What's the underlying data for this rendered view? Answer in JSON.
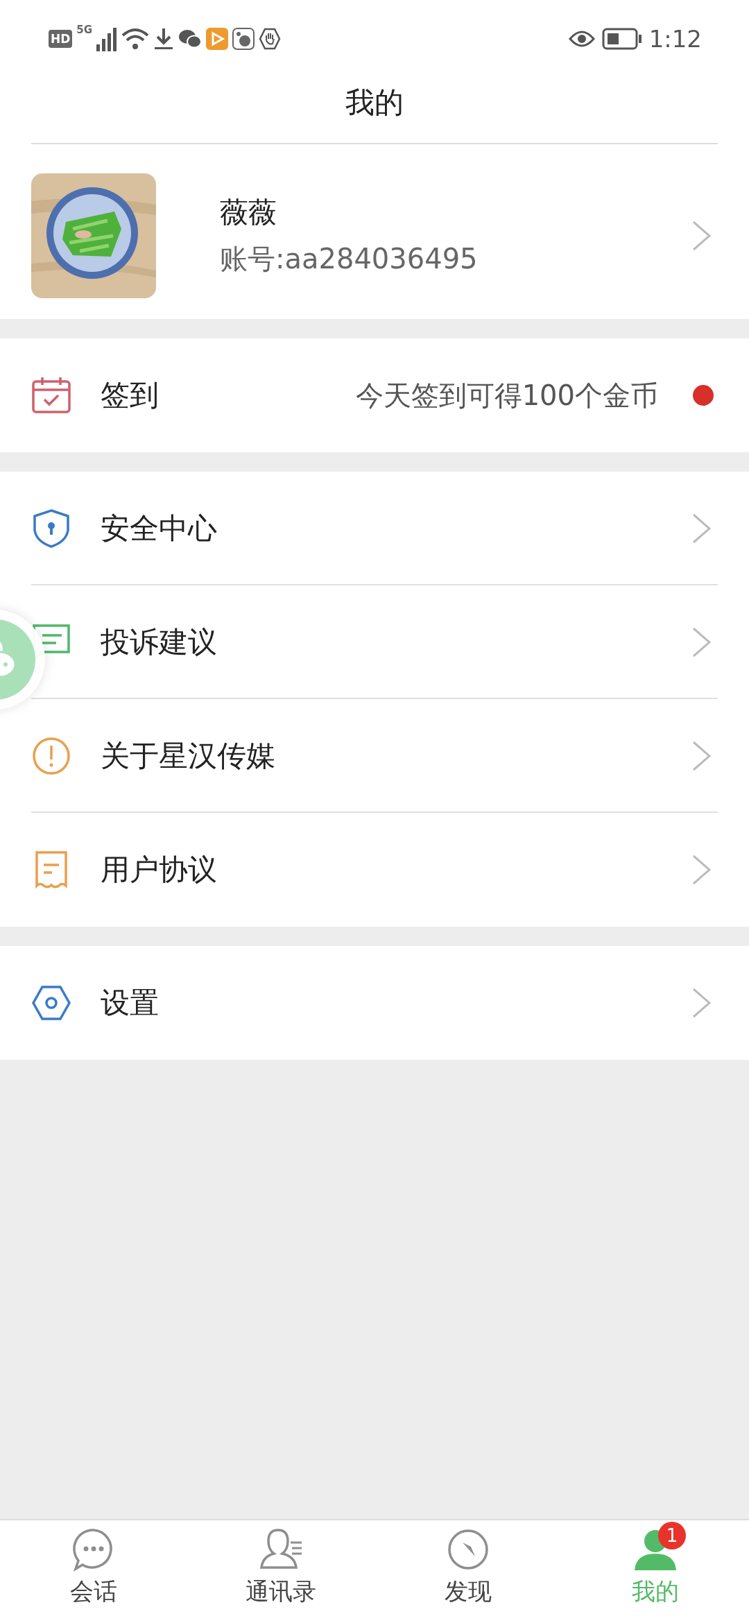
{
  "status_bar": {
    "badges": [
      "HD",
      "5G"
    ],
    "time": "1:12"
  },
  "header": {
    "title": "我的"
  },
  "profile": {
    "name": "薇薇",
    "account": "账号:aa284036495"
  },
  "groups": [
    {
      "items": [
        {
          "kind": "checkin",
          "color": "#d0606e",
          "label": "签到",
          "note": "今天签到可得100个金币",
          "unread": true
        }
      ]
    },
    {
      "items": [
        {
          "kind": "link",
          "color": "#3b7ac6",
          "label": "安全中心"
        },
        {
          "kind": "link",
          "color": "#4fb86a",
          "label": "投诉建议"
        },
        {
          "kind": "link",
          "color": "#e8a04e",
          "label": "关于星汉传媒"
        },
        {
          "kind": "link",
          "color": "#e8a04e",
          "label": "用户协议"
        }
      ]
    },
    {
      "items": [
        {
          "kind": "link",
          "color": "#3b7ac6",
          "label": "设置"
        }
      ]
    }
  ],
  "tab_bar": [
    {
      "label": "会话",
      "selected": false
    },
    {
      "label": "通讯录",
      "selected": false
    },
    {
      "label": "发现",
      "selected": false
    },
    {
      "label": "我的",
      "selected": true,
      "badge": "1"
    }
  ]
}
